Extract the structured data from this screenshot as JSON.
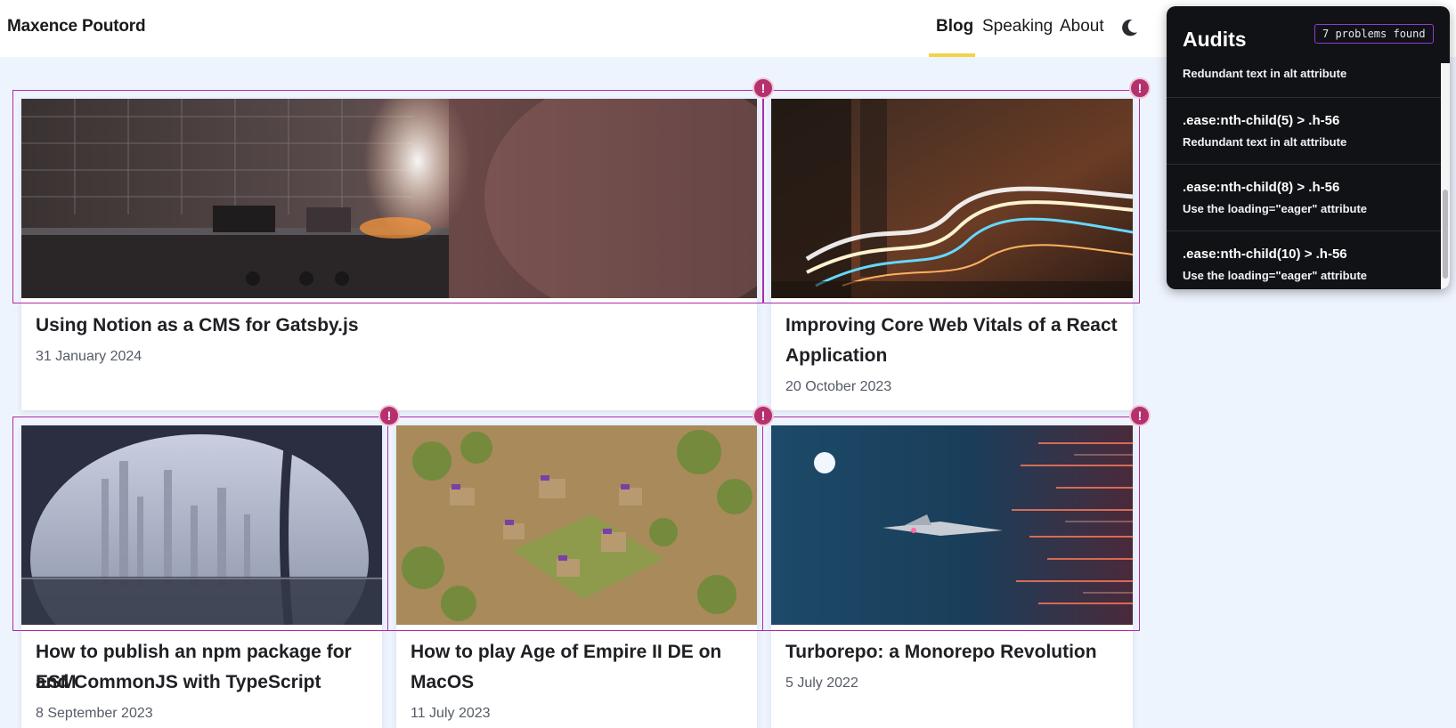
{
  "header": {
    "brand": "Maxence Poutord",
    "nav": [
      {
        "label": "Blog",
        "active": true
      },
      {
        "label": "Speaking",
        "active": false
      },
      {
        "label": "About",
        "active": false
      }
    ],
    "theme_toggle_icon": "moon-icon"
  },
  "posts": [
    {
      "title_lines": [
        "Using Notion as a CMS for Gatsby.js"
      ],
      "date": "31 January 2024",
      "image": "kitchen-flames"
    },
    {
      "title_lines": [
        "Improving Core Web Vitals of a React",
        "Application"
      ],
      "date": "20 October 2023",
      "image": "light-trails-tunnel"
    },
    {
      "title_lines": [
        "How to publish an npm package for ESM",
        "and CommonJS with TypeScript"
      ],
      "date": "8 September 2023",
      "image": "futuristic-city-window"
    },
    {
      "title_lines": [
        "How to play Age of Empire II DE on",
        "MacOS"
      ],
      "date": "11 July 2023",
      "image": "age-of-empires-village"
    },
    {
      "title_lines": [
        "Turborepo: a Monorepo Revolution"
      ],
      "date": "5 July 2022",
      "image": "jet-warp-speed"
    }
  ],
  "audit_marker_icon": "alert-icon",
  "audits": {
    "title": "Audits",
    "badge": "7 problems found",
    "items": [
      {
        "selector": "",
        "issue": "Redundant text in alt attribute"
      },
      {
        "selector": ".ease:nth-child(5) > .h-56",
        "issue": "Redundant text in alt attribute"
      },
      {
        "selector": ".ease:nth-child(8) > .h-56",
        "issue": "Use the loading=\"eager\" attribute"
      },
      {
        "selector": ".ease:nth-child(10) > .h-56",
        "issue": "Use the loading=\"eager\" attribute"
      }
    ]
  },
  "colors": {
    "page_bg": "#eef4fe",
    "accent_underline": "#f1d44c",
    "audit_outline": "#b02aa8",
    "audit_badge": "#b5316e",
    "panel_bg": "#111216"
  }
}
